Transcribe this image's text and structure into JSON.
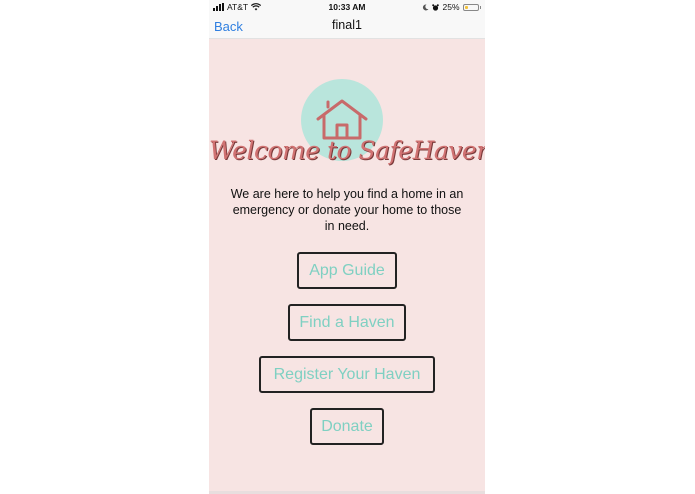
{
  "status_bar": {
    "carrier": "AT&T",
    "time": "10:33 AM",
    "battery": "25%",
    "battery_level": 0.25,
    "icons": [
      "signal-icon",
      "wifi-icon",
      "moon-icon",
      "alarm-icon",
      "battery-icon"
    ]
  },
  "nav": {
    "back_label": "Back",
    "title": "final1"
  },
  "hero": {
    "logo_icon": "house-icon",
    "title": "Welcome to SafeHaven",
    "tagline": "We are here to help you find a home in an emergency or donate your home to those in need."
  },
  "buttons": {
    "app_guide": "App Guide",
    "find_haven": "Find a Haven",
    "register_haven": "Register Your Haven",
    "donate": "Donate"
  },
  "colors": {
    "background": "#f7e4e3",
    "accent_teal": "#7fd0c2",
    "logo_circle": "#b9e5dc",
    "title_rose": "#d07272",
    "link_blue": "#2f7fe0",
    "battery_yellow": "#f2c23a"
  }
}
